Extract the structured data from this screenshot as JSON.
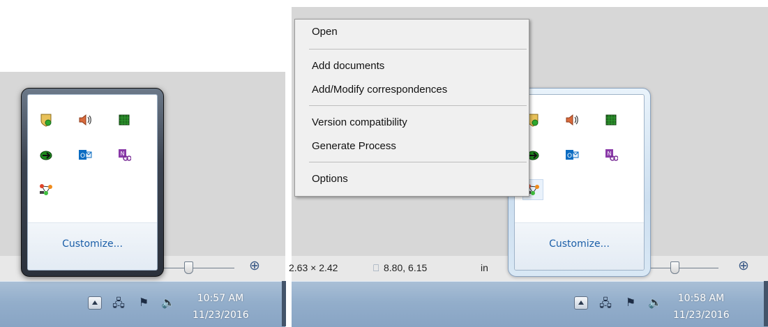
{
  "left_panel": {
    "overflow_customize_label": "Customize...",
    "clock_time": "10:57 AM",
    "clock_date": "11/23/2016"
  },
  "right_panel": {
    "context_menu": {
      "items": [
        {
          "label": "Open"
        },
        {
          "label": "Add documents"
        },
        {
          "label": "Add/Modify correspondences"
        },
        {
          "label": "Version compatibility"
        },
        {
          "label": "Generate Process"
        },
        {
          "label": "Options"
        }
      ]
    },
    "status_bar": {
      "dimensions_text": "2.63 × 2.42",
      "position_text": "8.80, 6.15",
      "unit_label": "in"
    },
    "overflow_customize_label": "Customize...",
    "clock_time": "10:58 AM",
    "clock_date": "11/23/2016"
  },
  "tray_icon_names": [
    "security-shield-icon",
    "volume-icon",
    "green-grid-icon",
    "green-sync-icon",
    "outlook-icon",
    "onenote-clipping-icon",
    "process-network-icon"
  ],
  "colors": {
    "customize_link": "#1a5ea8",
    "taskbar": "#93aecb",
    "desktop": "#d7d7d7"
  }
}
